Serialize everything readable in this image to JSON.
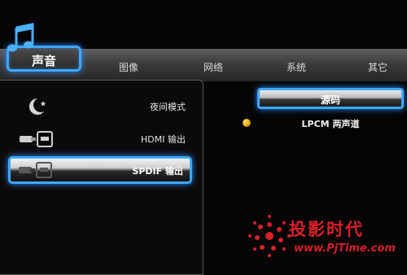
{
  "tabs": [
    {
      "label": "声音",
      "active": true
    },
    {
      "label": "图像",
      "active": false
    },
    {
      "label": "网络",
      "active": false
    },
    {
      "label": "系统",
      "active": false
    },
    {
      "label": "其它",
      "active": false
    }
  ],
  "tab_icon": "music-note-icon",
  "menu": {
    "items": [
      {
        "label": "夜间模式",
        "icon": "moon-star-icon",
        "selected": false
      },
      {
        "label": "HDMI 输出",
        "icon": "hdmi-connector-icon",
        "selected": false
      },
      {
        "label": "SPDIF 输出",
        "icon": "spdif-connector-icon",
        "selected": true
      }
    ]
  },
  "detail": {
    "option_label": "源码",
    "value": "LPCM 两声道"
  },
  "watermark": {
    "title": "投影时代",
    "url": "www.PjTime.com"
  },
  "colors": {
    "accent": "#3ea8ff",
    "watermark": "#d81f2a",
    "bullet": "#e0a000"
  }
}
